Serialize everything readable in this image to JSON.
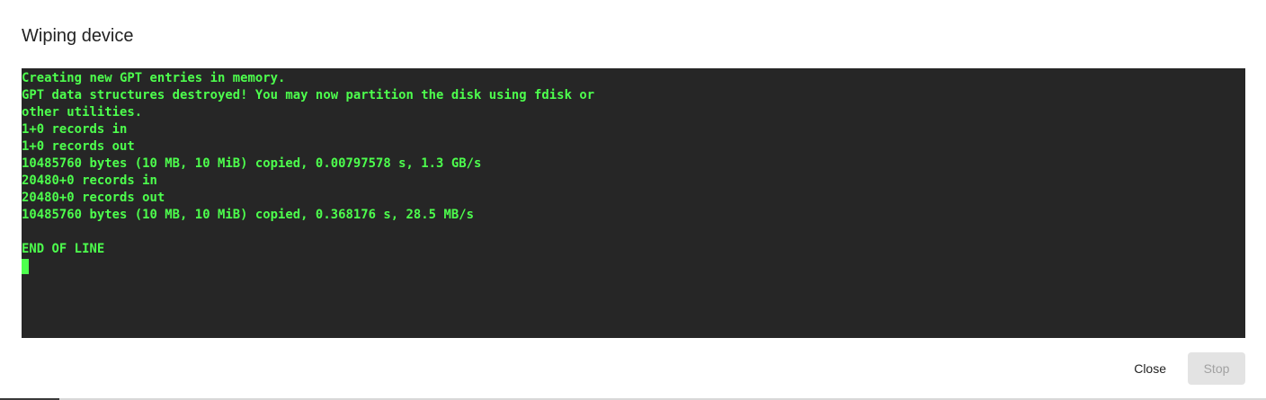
{
  "dialog": {
    "title": "Wiping device"
  },
  "terminal": {
    "lines": [
      "Creating new GPT entries in memory.",
      "GPT data structures destroyed! You may now partition the disk using fdisk or",
      "other utilities.",
      "1+0 records in",
      "1+0 records out",
      "10485760 bytes (10 MB, 10 MiB) copied, 0.00797578 s, 1.3 GB/s",
      "20480+0 records in",
      "20480+0 records out",
      "10485760 bytes (10 MB, 10 MiB) copied, 0.368176 s, 28.5 MB/s",
      "",
      "END OF LINE"
    ],
    "text_color": "#4dff4d",
    "background_color": "#262626"
  },
  "footer": {
    "close_label": "Close",
    "stop_label": "Stop",
    "stop_disabled": true
  }
}
